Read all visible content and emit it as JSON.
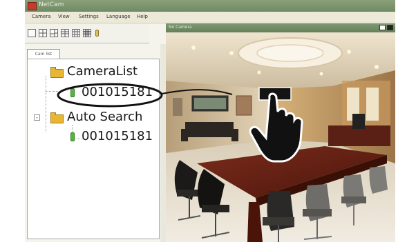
{
  "window": {
    "title": "NetCam",
    "menu": [
      "Camera",
      "View",
      "Settings",
      "Language",
      "Help"
    ]
  },
  "toolbar": {
    "buttons": [
      "view-1-icon",
      "view-4-icon",
      "view-6-icon",
      "view-8-icon",
      "view-9-icon",
      "view-16-icon",
      "microphone-icon"
    ]
  },
  "sidebar": {
    "tab_label": "Cam list",
    "tree": [
      {
        "label": "CameraList",
        "icon": "folder-icon",
        "children": [
          {
            "label": "001015181",
            "icon": "camera-icon"
          }
        ]
      },
      {
        "label": "Auto Search",
        "icon": "folder-icon",
        "children": [
          {
            "label": "001015181",
            "icon": "camera-icon"
          }
        ]
      }
    ]
  },
  "video_pane": {
    "title": "No Camera"
  },
  "colors": {
    "titlebar": "#6f8a64",
    "folder": "#e8b632",
    "camera_online": "#52b63a"
  }
}
